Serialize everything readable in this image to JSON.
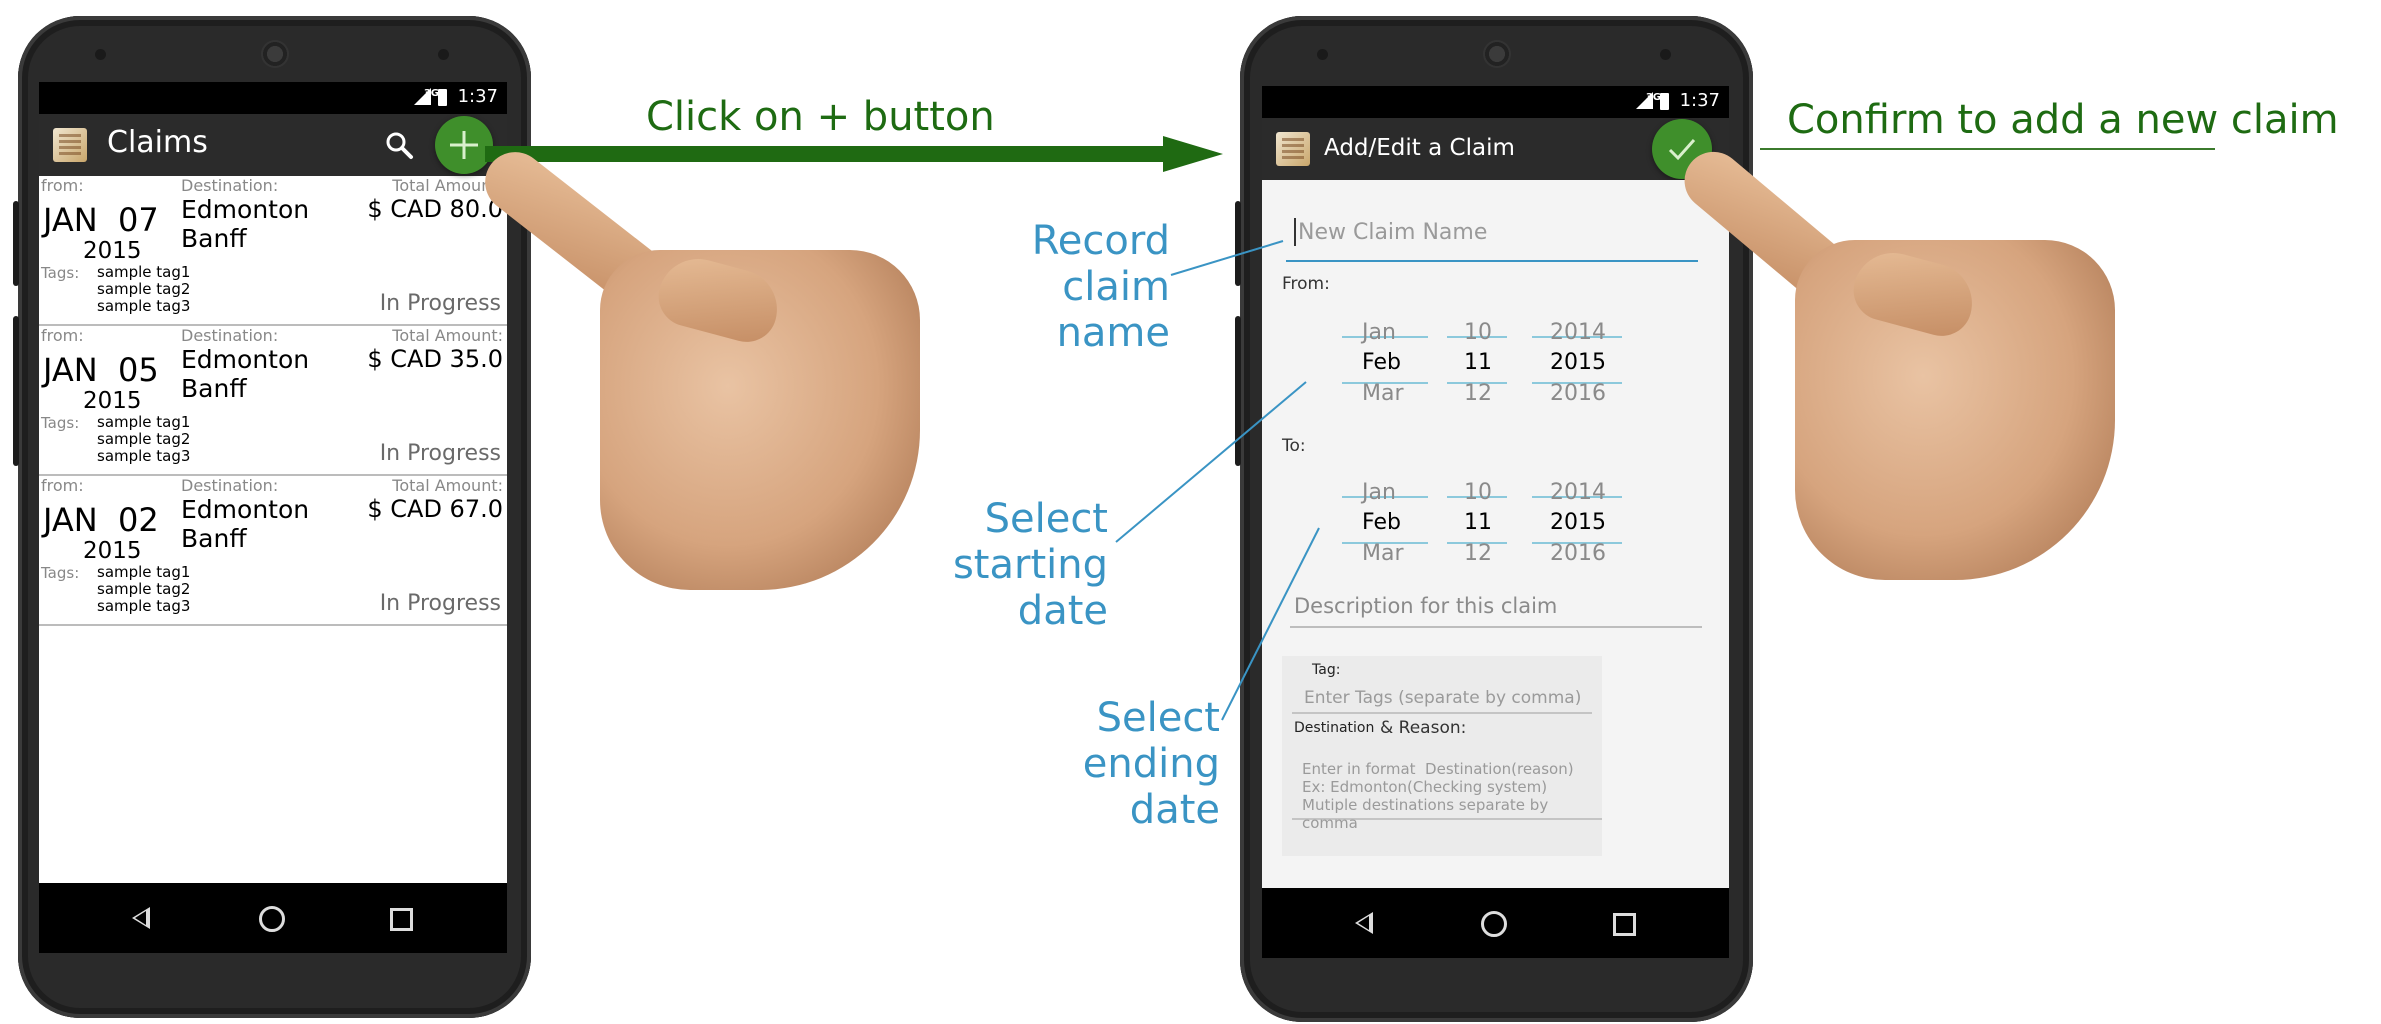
{
  "left_phone": {
    "status_time": "1:37",
    "status_signal": "3G",
    "title": "Claims",
    "icons": {
      "app": "app-logo-icon",
      "search": "search-icon",
      "add": "plus-icon"
    },
    "claims": [
      {
        "from_label": "from:",
        "dest_label": "Destination:",
        "amount_label": "Total Amount:",
        "date": "JAN  07",
        "year": "2015",
        "destination_line1": "Edmonton",
        "destination_line2": "Banff",
        "amount": "$ CAD 80.0",
        "tags_label": "Tags:",
        "tags": [
          "sample tag1",
          "sample tag2",
          "sample tag3"
        ],
        "status": "In Progress"
      },
      {
        "from_label": "from:",
        "dest_label": "Destination:",
        "amount_label": "Total Amount:",
        "date": "JAN  05",
        "year": "2015",
        "destination_line1": "Edmonton",
        "destination_line2": "Banff",
        "amount": "$ CAD 35.0",
        "tags_label": "Tags:",
        "tags": [
          "sample tag1",
          "sample tag2",
          "sample tag3"
        ],
        "status": "In Progress"
      },
      {
        "from_label": "from:",
        "dest_label": "Destination:",
        "amount_label": "Total Amount:",
        "date": "JAN  02",
        "year": "2015",
        "destination_line1": "Edmonton",
        "destination_line2": "Banff",
        "amount": "$ CAD 67.0",
        "tags_label": "Tags:",
        "tags": [
          "sample tag1",
          "sample tag2",
          "sample tag3"
        ],
        "status": "In Progress"
      }
    ]
  },
  "right_phone": {
    "status_time": "1:37",
    "status_signal": "3G",
    "title": "Add/Edit a Claim",
    "icons": {
      "app": "app-logo-icon",
      "confirm": "checkmark-icon"
    },
    "name_placeholder": "New Claim Name",
    "from_label": "From:",
    "to_label": "To:",
    "from_picker": {
      "prev": [
        "Jan",
        "10",
        "2014"
      ],
      "current": [
        "Feb",
        "11",
        "2015"
      ],
      "next": [
        "Mar",
        "12",
        "2016"
      ]
    },
    "to_picker": {
      "prev": [
        "Jan",
        "10",
        "2014"
      ],
      "current": [
        "Feb",
        "11",
        "2015"
      ],
      "next": [
        "Mar",
        "12",
        "2016"
      ]
    },
    "description_placeholder": "Description for this claim",
    "tag_label": "Tag:",
    "tag_placeholder": "Enter Tags (separate by comma)",
    "destination_label": "Destination",
    "reason_label": "& Reason:",
    "destination_placeholder_lines": [
      "Enter in format  Destination(reason)",
      "Ex: Edmonton(Checking system)",
      "Mutiple destinations separate by comma"
    ]
  },
  "annotations": {
    "click_plus": "Click on + button",
    "confirm": "Confirm to add a new claim",
    "record_name": [
      "Record",
      "claim",
      "name"
    ],
    "start_date": [
      "Select",
      "starting",
      "date"
    ],
    "end_date": [
      "Select",
      "ending",
      "date"
    ],
    "colors": {
      "green": "#1e6b12",
      "blue": "#3a94c4",
      "arrow": "#1f6a12"
    }
  }
}
